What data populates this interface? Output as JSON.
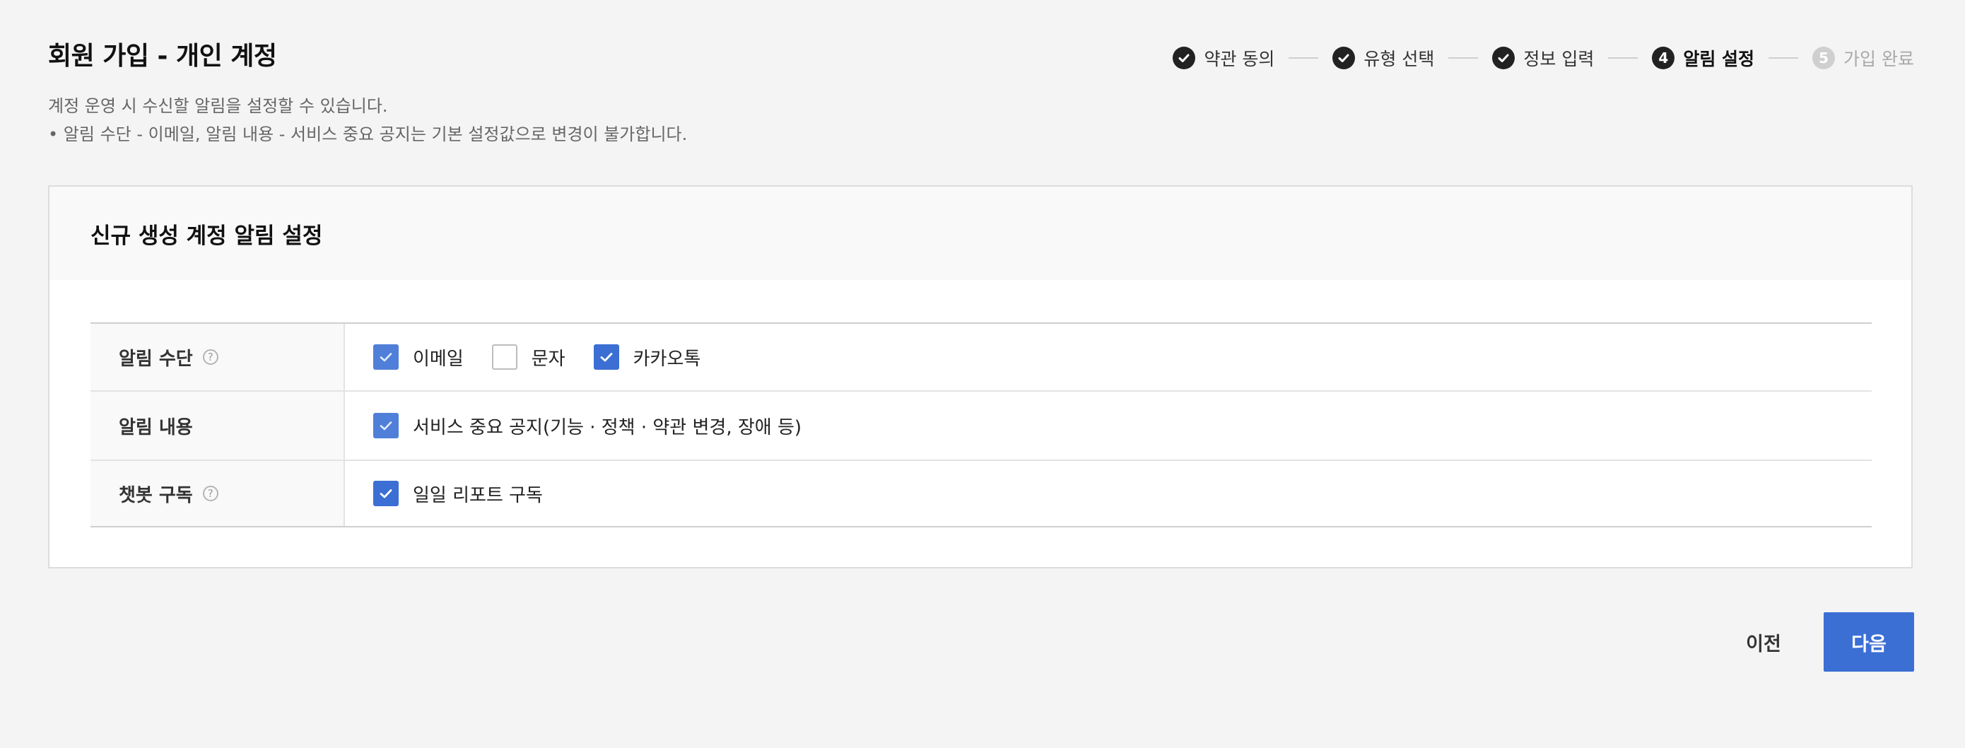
{
  "page": {
    "title": "회원 가입 - 개인 계정"
  },
  "stepper": {
    "steps": [
      {
        "label": "약관 동의",
        "status": "done",
        "number": "1"
      },
      {
        "label": "유형 선택",
        "status": "done",
        "number": "2"
      },
      {
        "label": "정보 입력",
        "status": "done",
        "number": "3"
      },
      {
        "label": "알림 설정",
        "status": "active",
        "number": "4"
      },
      {
        "label": "가입 완료",
        "status": "pending",
        "number": "5"
      }
    ]
  },
  "description": {
    "line1": "계정 운영 시 수신할 알림을 설정할 수 있습니다.",
    "line2": "• 알림 수단 - 이메일, 알림 내용 - 서비스 중요 공지는 기본 설정값으로 변경이 불가합니다."
  },
  "card": {
    "title": "신규 생성 계정 알림 설정",
    "rows": [
      {
        "label": "알림 수단",
        "options": [
          {
            "label": "이메일",
            "checked": true,
            "disabled": true
          },
          {
            "label": "문자",
            "checked": false,
            "disabled": false
          },
          {
            "label": "카카오톡",
            "checked": true,
            "disabled": false
          }
        ]
      },
      {
        "label": "알림 내용",
        "options": [
          {
            "label": "서비스 중요 공지(기능 · 정책 · 약관 변경, 장애 등)",
            "checked": true,
            "disabled": true
          }
        ]
      },
      {
        "label": "챗봇 구독",
        "options": [
          {
            "label": "일일 리포트 구독",
            "checked": true,
            "disabled": false
          }
        ]
      }
    ]
  },
  "buttons": {
    "prev": "이전",
    "next": "다음"
  },
  "colors": {
    "primary": "#3b6fd4",
    "background": "#f4f4f4"
  }
}
